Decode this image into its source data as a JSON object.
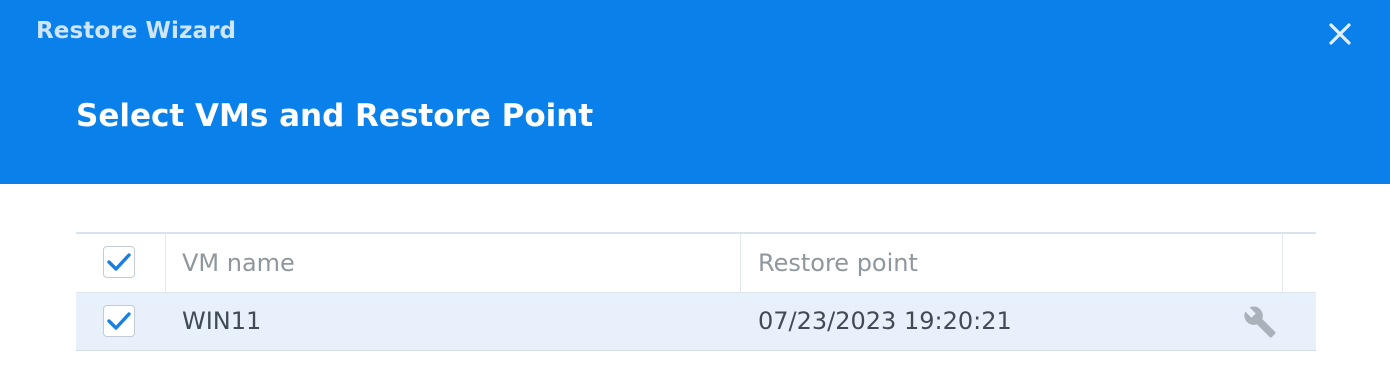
{
  "window": {
    "title": "Restore Wizard",
    "close_icon": "close-icon"
  },
  "step": {
    "title": "Select VMs and Restore Point"
  },
  "colors": {
    "header_bg": "#0a80ea",
    "row_selected_bg": "#e8f1fb",
    "check_color": "#1a7fe0"
  },
  "table": {
    "header": {
      "select_all_checked": true,
      "columns": [
        "VM name",
        "Restore point"
      ]
    },
    "rows": [
      {
        "checked": true,
        "vm_name": "WIN11",
        "restore_point": "07/23/2023 19:20:21",
        "action_icon": "wrench-icon"
      }
    ]
  }
}
